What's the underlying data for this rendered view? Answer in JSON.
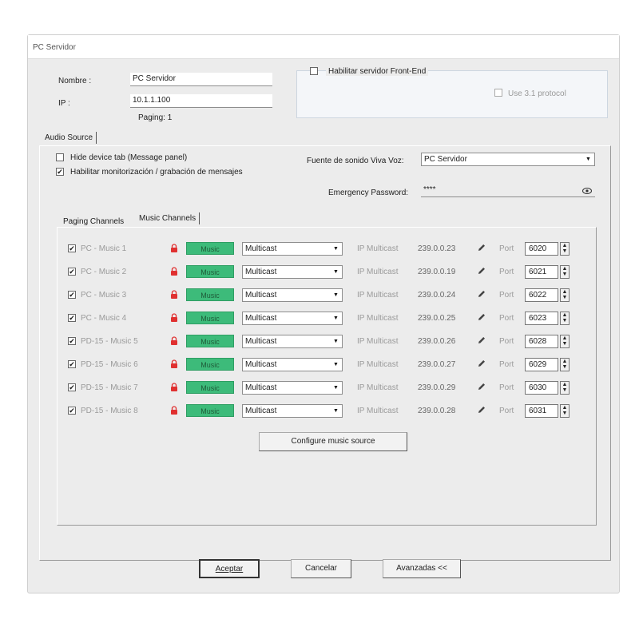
{
  "window": {
    "title": "PC Servidor"
  },
  "form": {
    "nombre_label": "Nombre :",
    "nombre_value": "PC Servidor",
    "ip_label": "IP :",
    "ip_value": "10.1.1.100",
    "paging_text": "Paging:  1"
  },
  "frontend": {
    "enable_label": "Habilitar servidor Front-End",
    "use31_label": "Use 3.1 protocol"
  },
  "tabs": {
    "audio_source": "Audio Source"
  },
  "audio": {
    "hide_tab_label": "Hide device tab (Message panel)",
    "hide_tab_checked": false,
    "monitor_label": "Habilitar monitorización / grabación de mensajes",
    "monitor_checked": true,
    "fuente_label": "Fuente de sonido Viva Voz:",
    "fuente_value": "PC Servidor",
    "emergency_label": "Emergency Password:",
    "emergency_value": "****"
  },
  "subtabs": {
    "paging": "Paging Channels",
    "music": "Music Channels"
  },
  "channels": [
    {
      "name": "PC - Music 1",
      "badge": "Music",
      "mode": "Multicast",
      "ipm_label": "IP Multicast",
      "ip": "239.0.0.23",
      "port_label": "Port",
      "port": "6020"
    },
    {
      "name": "PC - Music 2",
      "badge": "Music",
      "mode": "Multicast",
      "ipm_label": "IP Multicast",
      "ip": "239.0.0.19",
      "port_label": "Port",
      "port": "6021"
    },
    {
      "name": "PC - Music 3",
      "badge": "Music",
      "mode": "Multicast",
      "ipm_label": "IP Multicast",
      "ip": "239.0.0.24",
      "port_label": "Port",
      "port": "6022"
    },
    {
      "name": "PC - Music 4",
      "badge": "Music",
      "mode": "Multicast",
      "ipm_label": "IP Multicast",
      "ip": "239.0.0.25",
      "port_label": "Port",
      "port": "6023"
    },
    {
      "name": "PD-15 - Music 5",
      "badge": "Music",
      "mode": "Multicast",
      "ipm_label": "IP Multicast",
      "ip": "239.0.0.26",
      "port_label": "Port",
      "port": "6028"
    },
    {
      "name": "PD-15 - Music 6",
      "badge": "Music",
      "mode": "Multicast",
      "ipm_label": "IP Multicast",
      "ip": "239.0.0.27",
      "port_label": "Port",
      "port": "6029"
    },
    {
      "name": "PD-15 - Music 7",
      "badge": "Music",
      "mode": "Multicast",
      "ipm_label": "IP Multicast",
      "ip": "239.0.0.29",
      "port_label": "Port",
      "port": "6030"
    },
    {
      "name": "PD-15 - Music 8",
      "badge": "Music",
      "mode": "Multicast",
      "ipm_label": "IP Multicast",
      "ip": "239.0.0.28",
      "port_label": "Port",
      "port": "6031"
    }
  ],
  "buttons": {
    "configure": "Configure music source",
    "aceptar": "Aceptar",
    "cancelar": "Cancelar",
    "avanzadas": "Avanzadas <<"
  },
  "colors": {
    "music_badge": "#3dbb7a",
    "lock": "#e03030"
  }
}
